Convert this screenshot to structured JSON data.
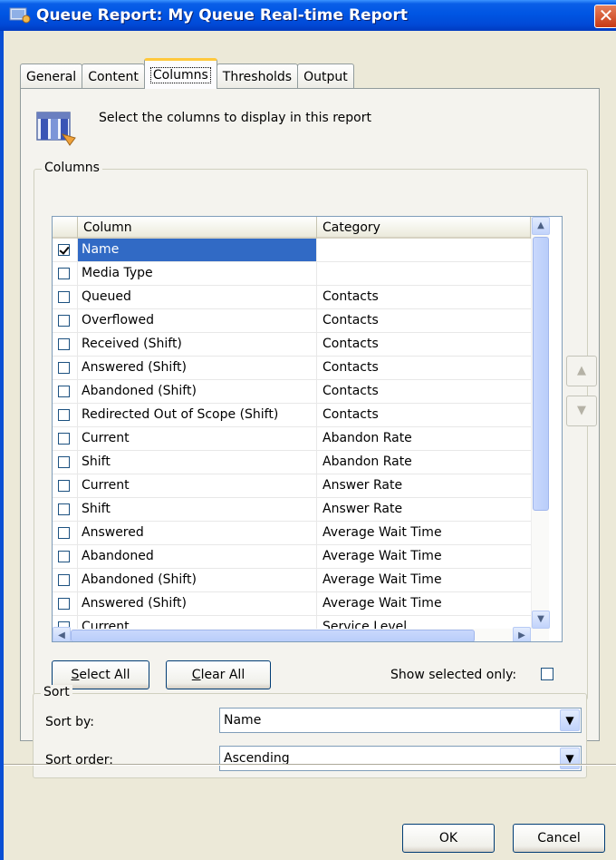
{
  "window": {
    "title": "Queue Report: My Queue Real-time Report",
    "close_glyph": "✕"
  },
  "tabs": [
    {
      "label": "General",
      "active": false
    },
    {
      "label": "Content",
      "active": false
    },
    {
      "label": "Columns",
      "active": true
    },
    {
      "label": "Thresholds",
      "active": false
    },
    {
      "label": "Output",
      "active": false
    }
  ],
  "header": {
    "icon": "columns-table-icon",
    "text": "Select the columns to display in this report"
  },
  "columns_group": {
    "legend": "Columns",
    "list": {
      "headers": {
        "column": "Column",
        "category": "Category"
      },
      "rows": [
        {
          "checked": true,
          "column": "Name",
          "category": ""
        },
        {
          "checked": false,
          "column": "Media Type",
          "category": ""
        },
        {
          "checked": false,
          "column": "Queued",
          "category": "Contacts"
        },
        {
          "checked": false,
          "column": "Overflowed",
          "category": "Contacts"
        },
        {
          "checked": false,
          "column": "Received (Shift)",
          "category": "Contacts"
        },
        {
          "checked": false,
          "column": "Answered (Shift)",
          "category": "Contacts"
        },
        {
          "checked": false,
          "column": "Abandoned (Shift)",
          "category": "Contacts"
        },
        {
          "checked": false,
          "column": "Redirected Out of Scope (Shift)",
          "category": "Contacts"
        },
        {
          "checked": false,
          "column": "Current",
          "category": "Abandon Rate"
        },
        {
          "checked": false,
          "column": "Shift",
          "category": "Abandon Rate"
        },
        {
          "checked": false,
          "column": "Current",
          "category": "Answer Rate"
        },
        {
          "checked": false,
          "column": "Shift",
          "category": "Answer Rate"
        },
        {
          "checked": false,
          "column": "Answered",
          "category": "Average Wait Time"
        },
        {
          "checked": false,
          "column": "Abandoned",
          "category": "Average Wait Time"
        },
        {
          "checked": false,
          "column": "Abandoned (Shift)",
          "category": "Average Wait Time"
        },
        {
          "checked": false,
          "column": "Answered (Shift)",
          "category": "Average Wait Time"
        },
        {
          "checked": false,
          "column": "Current",
          "category": "Service Level"
        }
      ],
      "selected_index": 0
    },
    "move_up_icon": "move-up-icon",
    "move_down_icon": "move-down-icon",
    "select_all_accel": "S",
    "select_all_rest": "elect All",
    "clear_all_accel": "C",
    "clear_all_rest": "lear All",
    "show_selected_only_label": "Show selected only:",
    "show_selected_only_checked": false
  },
  "sort_group": {
    "legend": "Sort",
    "sort_by_label": "Sort by:",
    "sort_by_value": "Name",
    "sort_order_label": "Sort order:",
    "sort_order_value": "Ascending"
  },
  "footer": {
    "ok_label": "OK",
    "cancel_label": "Cancel"
  }
}
